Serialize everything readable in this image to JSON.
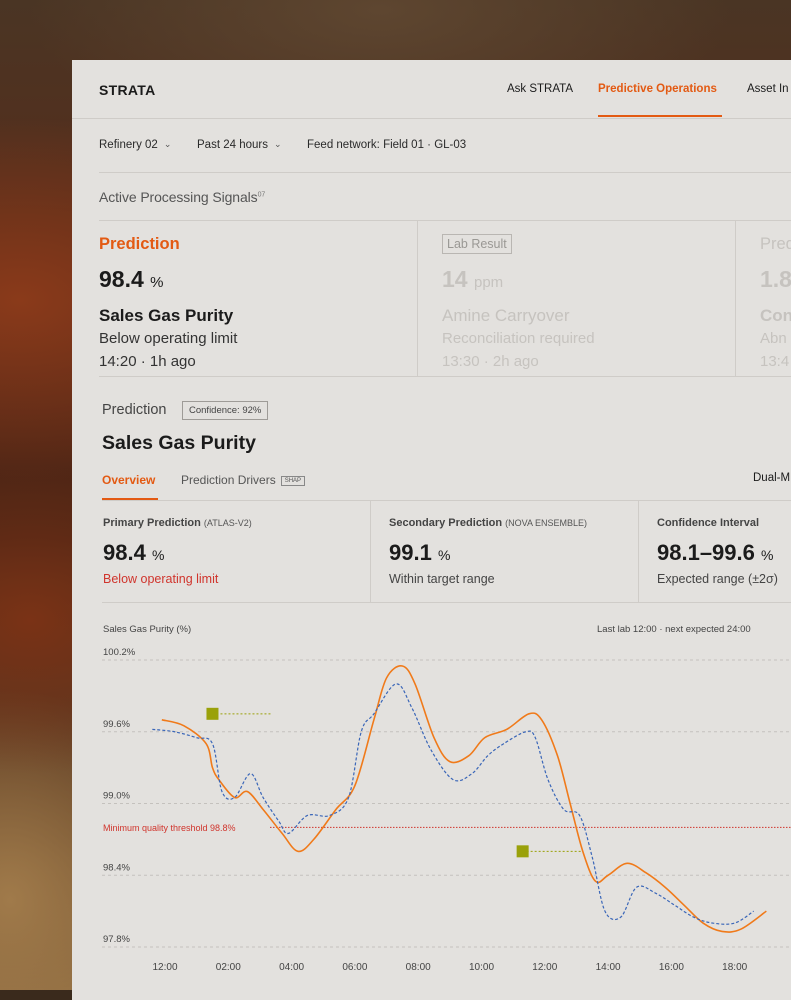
{
  "app": {
    "brand": "STRATA"
  },
  "nav": {
    "items": [
      {
        "label": "Ask STRATA",
        "active": false
      },
      {
        "label": "Predictive Operations",
        "active": true
      },
      {
        "label": "Asset In",
        "active": false
      }
    ]
  },
  "filters": {
    "refinery": "Refinery 02",
    "range": "Past 24 hours",
    "feed": "Feed network: Field 01 · GL-03"
  },
  "signals": {
    "title": "Active Processing Signals",
    "count": "07",
    "cards": [
      {
        "kicker": "Prediction",
        "value": "98.4",
        "unit": "%",
        "name": "Sales Gas Purity",
        "status": "Below operating limit",
        "time": "14:20 · 1h ago"
      },
      {
        "kicker": "Lab Result",
        "value": "14",
        "unit": "ppm",
        "name": "Amine Carryover",
        "status": "Reconciliation required",
        "time": "13:30 · 2h ago"
      },
      {
        "kicker": "Pred",
        "value": "1.8",
        "unit": "",
        "name": "Con",
        "status": "Abn",
        "time": "13:4"
      }
    ]
  },
  "detail": {
    "kicker": "Prediction",
    "confidence": "Confidence: 92%",
    "title": "Sales Gas Purity",
    "tabs": {
      "overview": "Overview",
      "drivers": "Prediction Drivers",
      "drivers_badge": "SHAP"
    },
    "mode": "Dual-M",
    "metrics": [
      {
        "label": "Primary Prediction",
        "model": "(ATLAS-V2)",
        "value": "98.4",
        "unit": "%",
        "status": "Below operating limit",
        "alert": true
      },
      {
        "label": "Secondary Prediction",
        "model": "(NOVA ENSEMBLE)",
        "value": "99.1",
        "unit": "%",
        "status": "Within target range",
        "alert": false
      },
      {
        "label": "Confidence Interval",
        "model": "",
        "value": "98.1–99.6",
        "unit": "%",
        "status": "Expected range (±2σ)",
        "alert": false
      }
    ]
  },
  "colors": {
    "accent": "#e35a13",
    "primary_series": "#f07a1a",
    "secondary_series": "#3a66b8",
    "threshold": "#d0342c",
    "lab_marker": "#9aa10a"
  },
  "chart_data": {
    "type": "line",
    "ylabel": "Sales Gas Purity (%)",
    "note": "Last lab 12:00 · next expected 24:00",
    "y_ticks": [
      "100.2%",
      "99.6%",
      "99.0%",
      "98.4%",
      "97.8%"
    ],
    "ylim": [
      97.8,
      100.2
    ],
    "x_ticks": [
      "12:00",
      "02:00",
      "04:00",
      "06:00",
      "08:00",
      "10:00",
      "12:00",
      "14:00",
      "16:00",
      "18:00"
    ],
    "grid": true,
    "threshold": {
      "label": "Minimum quality threshold 98.8%",
      "value": 98.8
    },
    "series": [
      {
        "values": [
          [
            -0.1,
            99.7
          ],
          [
            0.6,
            99.65
          ],
          [
            1.3,
            99.5
          ],
          [
            1.5,
            99.3
          ],
          [
            1.7,
            99.2
          ],
          [
            2.2,
            99.05
          ],
          [
            2.6,
            99.1
          ],
          [
            3.1,
            98.95
          ],
          [
            3.7,
            98.75
          ],
          [
            4.2,
            98.6
          ],
          [
            4.7,
            98.7
          ],
          [
            5.4,
            98.95
          ],
          [
            6.0,
            99.15
          ],
          [
            6.6,
            99.7
          ],
          [
            7.0,
            100.05
          ],
          [
            7.5,
            100.15
          ],
          [
            7.9,
            100.0
          ],
          [
            8.5,
            99.55
          ],
          [
            9.0,
            99.35
          ],
          [
            9.6,
            99.4
          ],
          [
            10.1,
            99.55
          ],
          [
            10.8,
            99.62
          ],
          [
            11.5,
            99.75
          ],
          [
            11.9,
            99.7
          ],
          [
            12.4,
            99.4
          ],
          [
            12.8,
            99.0
          ],
          [
            13.2,
            98.6
          ],
          [
            13.6,
            98.35
          ],
          [
            14.0,
            98.4
          ],
          [
            14.6,
            98.5
          ],
          [
            15.2,
            98.42
          ],
          [
            15.8,
            98.3
          ],
          [
            16.4,
            98.15
          ],
          [
            17.0,
            98.0
          ],
          [
            17.6,
            97.93
          ],
          [
            18.2,
            97.95
          ],
          [
            19.0,
            98.1
          ]
        ]
      },
      {
        "values": [
          [
            -0.4,
            99.62
          ],
          [
            0.3,
            99.6
          ],
          [
            1.0,
            99.55
          ],
          [
            1.5,
            99.5
          ],
          [
            1.8,
            99.1
          ],
          [
            2.2,
            99.05
          ],
          [
            2.7,
            99.25
          ],
          [
            3.1,
            99.05
          ],
          [
            3.6,
            98.85
          ],
          [
            3.9,
            98.75
          ],
          [
            4.5,
            98.9
          ],
          [
            5.2,
            98.9
          ],
          [
            5.8,
            99.05
          ],
          [
            6.2,
            99.6
          ],
          [
            6.6,
            99.75
          ],
          [
            7.3,
            100.0
          ],
          [
            7.8,
            99.8
          ],
          [
            8.4,
            99.45
          ],
          [
            9.1,
            99.2
          ],
          [
            9.7,
            99.25
          ],
          [
            10.2,
            99.4
          ],
          [
            10.7,
            99.5
          ],
          [
            11.4,
            99.6
          ],
          [
            11.7,
            99.55
          ],
          [
            12.1,
            99.2
          ],
          [
            12.6,
            98.95
          ],
          [
            13.1,
            98.9
          ],
          [
            13.5,
            98.55
          ],
          [
            13.9,
            98.1
          ],
          [
            14.4,
            98.05
          ],
          [
            14.9,
            98.3
          ],
          [
            15.5,
            98.25
          ],
          [
            16.1,
            98.15
          ],
          [
            16.7,
            98.05
          ],
          [
            17.3,
            98.0
          ],
          [
            18.0,
            98.0
          ],
          [
            18.6,
            98.1
          ]
        ]
      }
    ],
    "lab_markers": [
      [
        1.5,
        99.75
      ],
      [
        11.3,
        98.6
      ]
    ]
  }
}
